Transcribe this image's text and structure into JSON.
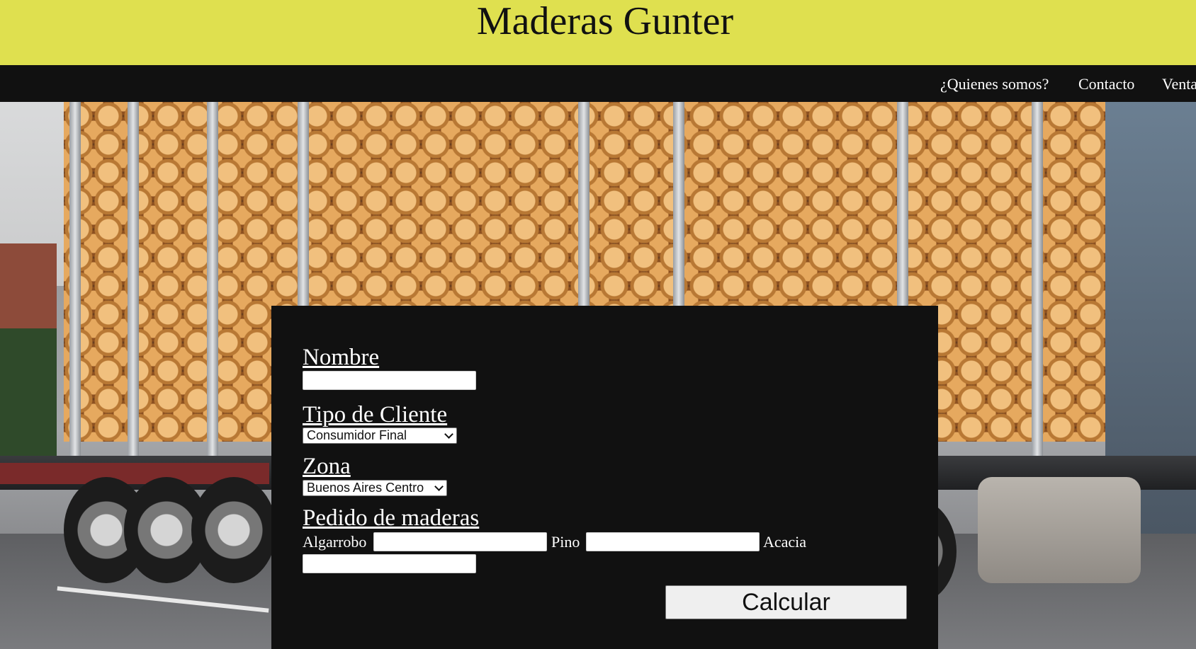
{
  "header": {
    "title": "Maderas Gunter",
    "background_color": "#dfe04f"
  },
  "nav": {
    "items": [
      {
        "label": "¿Quienes somos?"
      },
      {
        "label": "Contacto"
      },
      {
        "label": "Venta"
      }
    ]
  },
  "hero": {
    "image": "log-truck-photo"
  },
  "form": {
    "nombre": {
      "label": "Nombre",
      "value": ""
    },
    "tipo_cliente": {
      "label": "Tipo de Cliente",
      "selected": "Consumidor Final"
    },
    "zona": {
      "label": "Zona",
      "selected": "Buenos Aires Centro"
    },
    "pedido": {
      "label": "Pedido de maderas",
      "items": [
        {
          "label": "Algarrobo",
          "value": ""
        },
        {
          "label": "Pino",
          "value": ""
        },
        {
          "label": "Acacia",
          "value": ""
        }
      ]
    },
    "calcular_label": "Calcular"
  }
}
